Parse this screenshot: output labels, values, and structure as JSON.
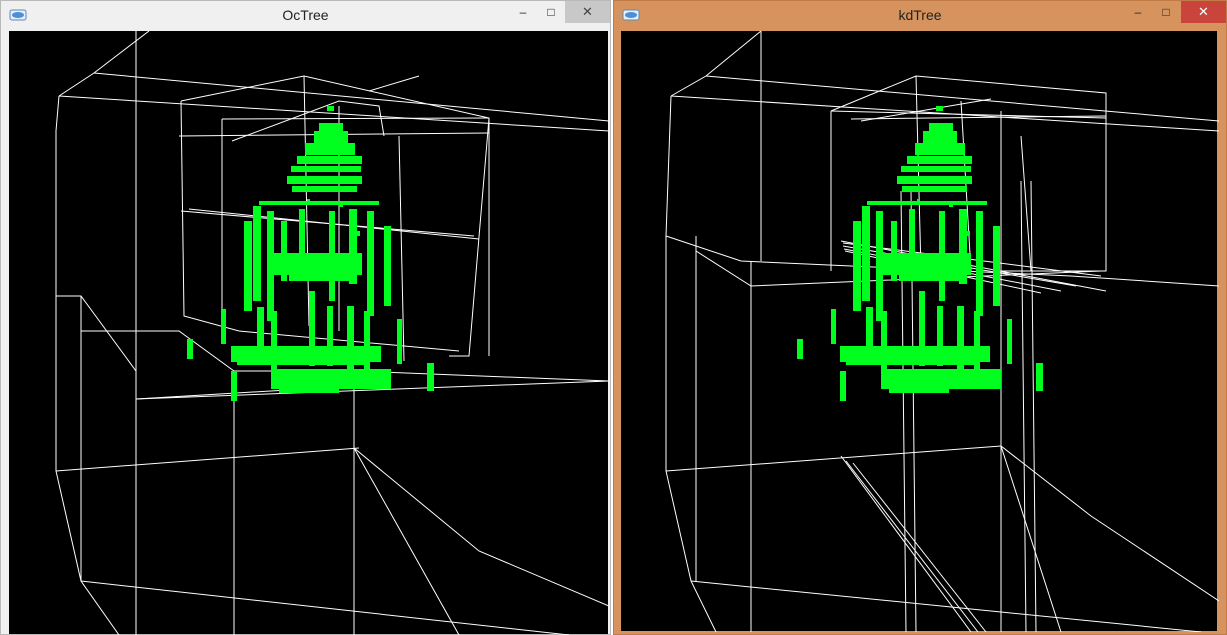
{
  "windows": [
    {
      "title": "OcTree",
      "controls": {
        "minimize": "–",
        "maximize": "□",
        "close": "✕"
      },
      "icon": "app-icon"
    },
    {
      "title": "kdTree",
      "controls": {
        "minimize": "–",
        "maximize": "□",
        "close": "✕"
      },
      "icon": "app-icon"
    }
  ],
  "colors": {
    "point_cloud": "#00ff1e",
    "wireframe": "#ffffff",
    "viewport_bg": "#000000",
    "kdtree_frame": "#d6935d",
    "octree_frame": "#f0f0f0"
  }
}
